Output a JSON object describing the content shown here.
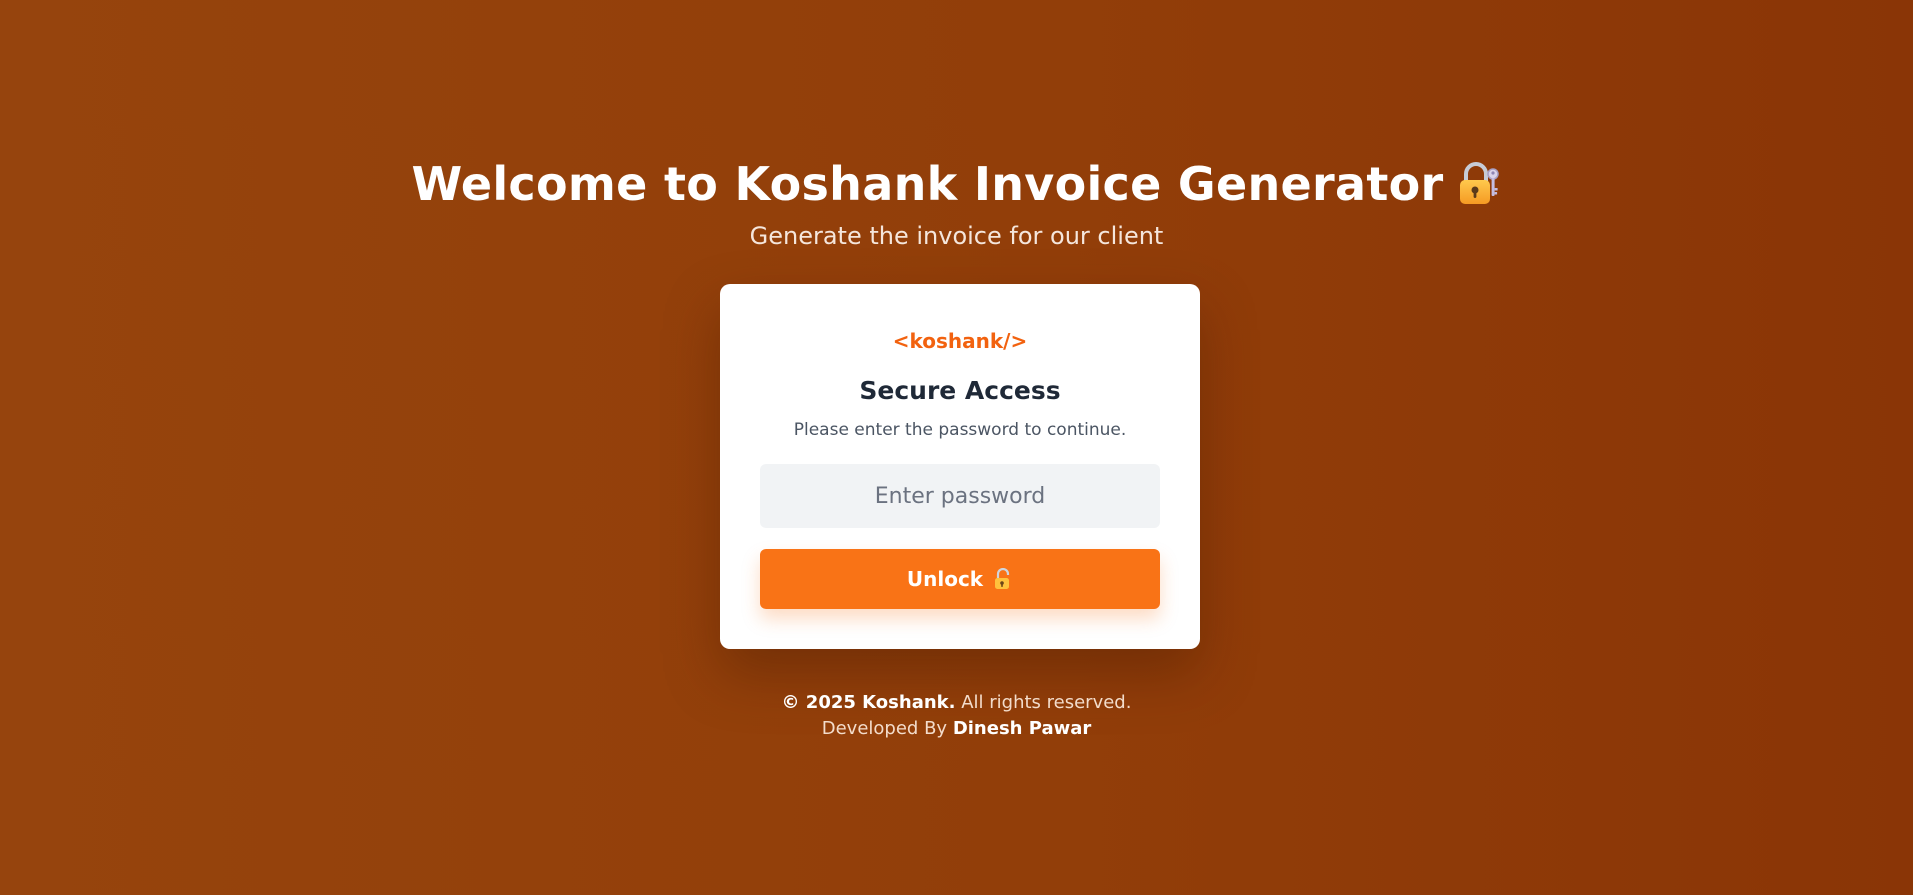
{
  "header": {
    "title": "Welcome to Koshank Invoice Generator",
    "title_icon": "lock-with-key-icon",
    "subtitle": "Generate the invoice for our client"
  },
  "card": {
    "brand": "<koshank/>",
    "title": "Secure Access",
    "subtitle": "Please enter the password to continue.",
    "password": {
      "placeholder": "Enter password",
      "value": ""
    },
    "unlock_label": "Unlock",
    "unlock_icon": "unlocked-padlock-icon"
  },
  "footer": {
    "copyright": "© 2025 Koshank.",
    "rights": "All rights reserved.",
    "developed_by_label": "Developed By",
    "developer": "Dinesh Pawar"
  },
  "colors": {
    "background": "#923e09",
    "accent": "#f97316",
    "brand": "#f2620f",
    "card": "#ffffff"
  }
}
